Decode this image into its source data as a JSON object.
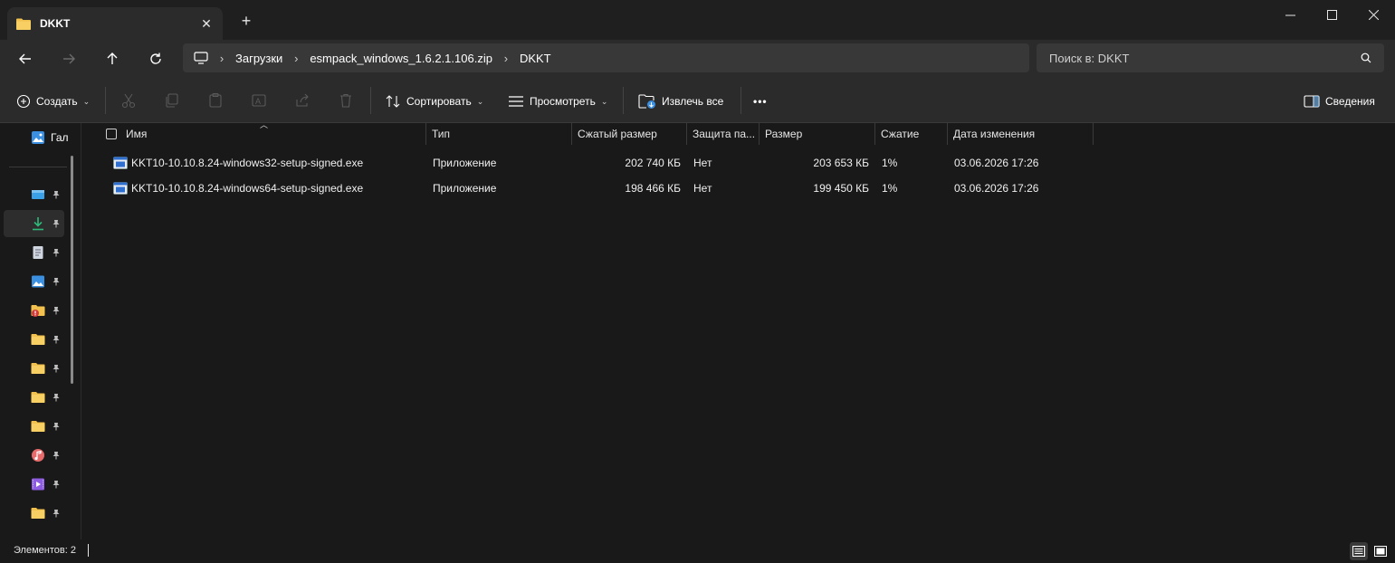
{
  "window": {
    "tab_title": "DKKT",
    "new_tab_label": "+",
    "minimize_label": "—",
    "maximize_label": "☐",
    "close_label": "✕"
  },
  "nav": {
    "breadcrumb": [
      "Загрузки",
      "esmpack_windows_1.6.2.1.106.zip",
      "DKKT"
    ],
    "search_placeholder": "Поиск в: DKKT"
  },
  "toolbar": {
    "create_label": "Создать",
    "sort_label": "Сортировать",
    "view_label": "Просмотреть",
    "extract_label": "Извлечь все",
    "more_label": "•••",
    "details_label": "Сведения"
  },
  "sidebar": {
    "gallery_label": "Гал",
    "items": [
      {
        "icon": "desktop-icon",
        "color": "#3aa0e8"
      },
      {
        "icon": "downloads-icon",
        "color": "#2fb87a",
        "active": true
      },
      {
        "icon": "documents-icon",
        "color": "#cfd6e0"
      },
      {
        "icon": "pictures-icon",
        "color": "#3b8fe0"
      },
      {
        "icon": "folder-error-icon",
        "color": "#f2c14e"
      },
      {
        "icon": "folder-icon",
        "color": "#f2c14e"
      },
      {
        "icon": "folder-icon",
        "color": "#f2c14e"
      },
      {
        "icon": "folder-icon",
        "color": "#f2c14e"
      },
      {
        "icon": "folder-icon",
        "color": "#f2c14e"
      },
      {
        "icon": "music-icon",
        "color": "#e86b6b"
      },
      {
        "icon": "videos-icon",
        "color": "#8d5ce0"
      },
      {
        "icon": "folder-icon",
        "color": "#f2c14e"
      }
    ]
  },
  "columns": {
    "name": "Имя",
    "type": "Тип",
    "compressed": "Сжатый размер",
    "protected": "Защита па...",
    "size": "Размер",
    "ratio": "Сжатие",
    "modified": "Дата изменения"
  },
  "files": [
    {
      "name": "KKT10-10.10.8.24-windows32-setup-signed.exe",
      "type": "Приложение",
      "compressed": "202 740 КБ",
      "protected": "Нет",
      "size": "203 653 КБ",
      "ratio": "1%",
      "modified": "03.06.2026 17:26"
    },
    {
      "name": "KKT10-10.10.8.24-windows64-setup-signed.exe",
      "type": "Приложение",
      "compressed": "198 466 КБ",
      "protected": "Нет",
      "size": "199 450 КБ",
      "ratio": "1%",
      "modified": "03.06.2026 17:26"
    }
  ],
  "status": {
    "items_count": "Элементов: 2"
  },
  "colors": {
    "background": "#191919",
    "toolbar": "#2b2b2b",
    "address": "#383838",
    "folder": "#f2c14e"
  }
}
